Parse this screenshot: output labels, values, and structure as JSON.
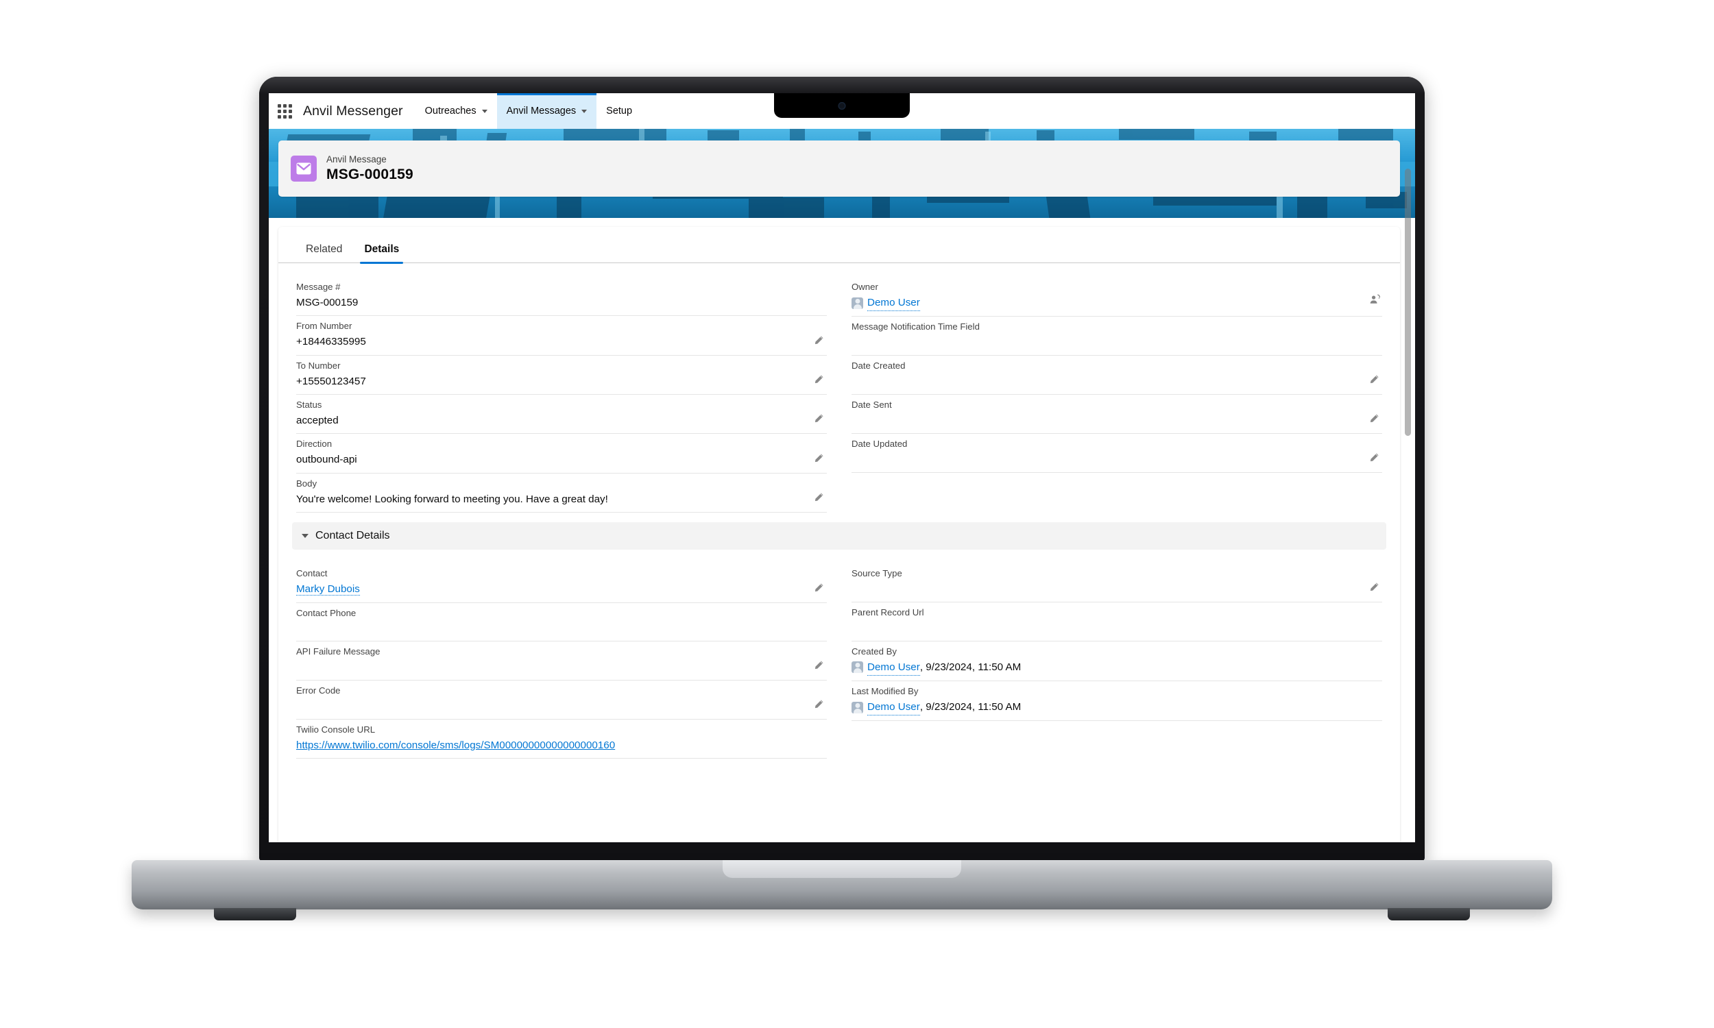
{
  "global_nav": {
    "app_launcher_icon": "app-launcher-grid-icon",
    "app_name": "Anvil Messenger",
    "tabs": [
      {
        "label": "Outreaches",
        "has_caret": true,
        "active": false
      },
      {
        "label": "Anvil Messages",
        "has_caret": true,
        "active": true
      },
      {
        "label": "Setup",
        "has_caret": false,
        "active": false
      }
    ]
  },
  "record_header": {
    "object_label": "Anvil Message",
    "record_name": "MSG-000159",
    "icon": "envelope-icon",
    "icon_color": "#bd7ce8"
  },
  "tabs": [
    {
      "label": "Related",
      "active": false
    },
    {
      "label": "Details",
      "active": true
    }
  ],
  "details": {
    "left": [
      {
        "label": "Message #",
        "value": "MSG-000159",
        "type": "text",
        "editable": false
      },
      {
        "label": "From Number",
        "value": "+18446335995",
        "type": "text",
        "editable": true
      },
      {
        "label": "To Number",
        "value": "+15550123457",
        "type": "text",
        "editable": true
      },
      {
        "label": "Status",
        "value": "accepted",
        "type": "text",
        "editable": true
      },
      {
        "label": "Direction",
        "value": "outbound-api",
        "type": "text",
        "editable": true
      },
      {
        "label": "Body",
        "value": "You're welcome! Looking forward to meeting you. Have a great day!",
        "type": "text",
        "editable": true
      }
    ],
    "right": [
      {
        "label": "Owner",
        "value": "Demo User",
        "type": "user-link",
        "editable": false,
        "owner_change": true
      },
      {
        "label": "Message Notification Time Field",
        "value": "",
        "type": "text",
        "editable": false
      },
      {
        "label": "Date Created",
        "value": "",
        "type": "text",
        "editable": true
      },
      {
        "label": "Date Sent",
        "value": "",
        "type": "text",
        "editable": true
      },
      {
        "label": "Date Updated",
        "value": "",
        "type": "text",
        "editable": true
      }
    ]
  },
  "contact_details": {
    "section_title": "Contact Details",
    "expanded": true,
    "left": [
      {
        "label": "Contact",
        "value": "Marky Dubois",
        "type": "link",
        "editable": true
      },
      {
        "label": "Contact Phone",
        "value": "",
        "type": "text",
        "editable": false
      },
      {
        "label": "API Failure Message",
        "value": "",
        "type": "text",
        "editable": true
      },
      {
        "label": "Error Code",
        "value": "",
        "type": "text",
        "editable": true
      },
      {
        "label": "Twilio Console URL",
        "value": "https://www.twilio.com/console/sms/logs/SM00000000000000000160",
        "type": "url",
        "editable": false
      }
    ],
    "right": [
      {
        "label": "Source Type",
        "value": "",
        "type": "text",
        "editable": true
      },
      {
        "label": "Parent Record Url",
        "value": "",
        "type": "text",
        "editable": false
      },
      {
        "label": "Created By",
        "value": "Demo User",
        "suffix": ", 9/23/2024, 11:50 AM",
        "type": "user-link",
        "editable": false
      },
      {
        "label": "Last Modified By",
        "value": "Demo User",
        "suffix": ", 9/23/2024, 11:50 AM",
        "type": "user-link",
        "editable": false
      }
    ]
  },
  "colors": {
    "brand_blue": "#0176d3",
    "active_tab_bg": "#d8edfb",
    "header_bg": "#f3f3f3",
    "record_icon": "#bd7ce8",
    "banner_blue": "#1a9ad6"
  }
}
